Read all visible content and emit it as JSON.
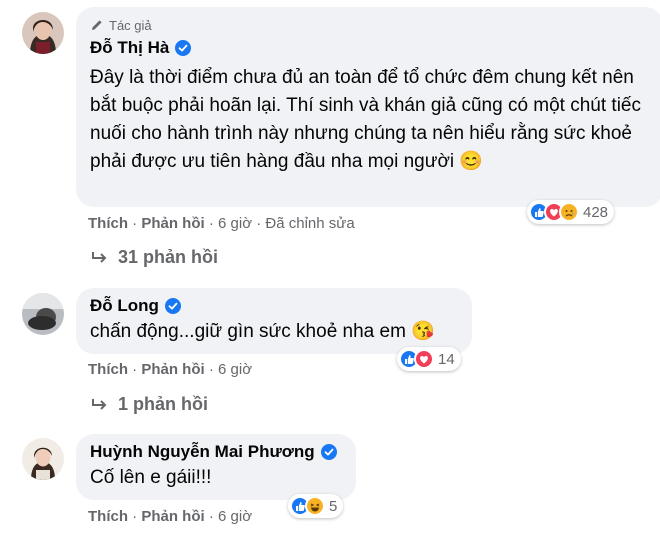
{
  "comments": [
    {
      "author_badge": "Tác giả",
      "author": "Đỗ Thị Hà",
      "text": "Đây là thời điểm chưa đủ an toàn để tổ chức đêm chung kết nên bắt buộc phải hoãn lại. Thí sinh và khán giả cũng có một chút tiếc nuối cho hành trình này nhưng chúng ta nên hiểu rằng sức khoẻ phải được ưu tiên hàng đầu nha mọi người 😊",
      "like": "Thích",
      "reply": "Phản hồi",
      "time": "6 giờ",
      "edited": "Đã chỉnh sửa",
      "reaction_count": "428",
      "reactions": [
        "like-icon",
        "love-icon",
        "sad-icon"
      ],
      "replies_label": "31 phản hồi"
    },
    {
      "author": "Đỗ Long",
      "text": "chấn động...giữ gìn sức khoẻ nha em 😘",
      "like": "Thích",
      "reply": "Phản hồi",
      "time": "6 giờ",
      "reaction_count": "14",
      "reactions": [
        "like-icon",
        "love-icon"
      ],
      "replies_label": "1 phản hồi"
    },
    {
      "author": "Huỳnh Nguyễn Mai Phương",
      "text": "Cố lên e gáii!!!",
      "like": "Thích",
      "reply": "Phản hồi",
      "time": "6 giờ",
      "reaction_count": "5",
      "reactions": [
        "like-icon",
        "haha-icon"
      ]
    }
  ],
  "colors": {
    "bubble": "#f0f2f5",
    "meta": "#65676b",
    "verified": "#1877f2",
    "like": "#1877f2",
    "love": "#f33e58",
    "reaction_yellow": "#f7b125"
  }
}
